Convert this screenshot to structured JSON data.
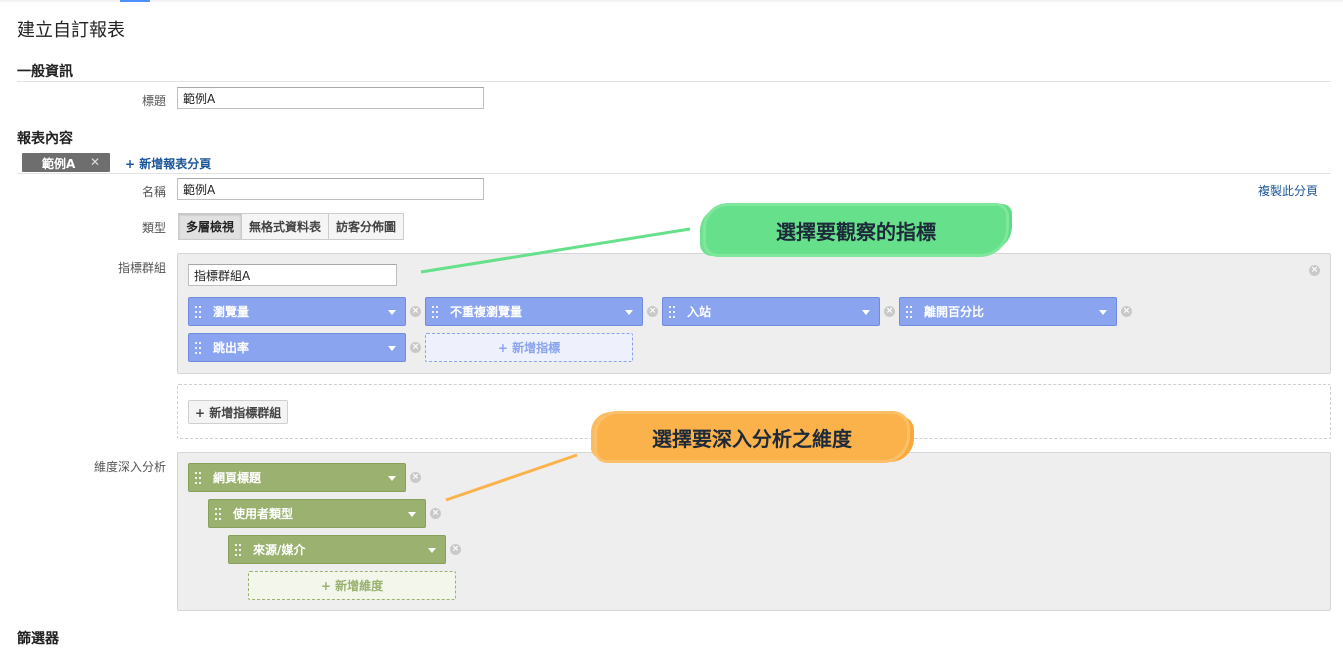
{
  "page": {
    "title": "建立自訂報表"
  },
  "general": {
    "section_title": "一般資訊",
    "title_label": "標題",
    "title_value": "範例A"
  },
  "content": {
    "section_title": "報表內容",
    "tab_label": "範例A",
    "tab_close": "✕",
    "add_tab_label": "+ 新增報表分頁",
    "copy_tab_label": "複製此分頁",
    "name_label": "名稱",
    "name_value": "範例A",
    "type_label": "類型",
    "types": [
      "多層檢視",
      "無格式資料表",
      "訪客分佈圖"
    ],
    "selected_type": "多層檢視"
  },
  "metrics": {
    "label": "指標群組",
    "group_name": "指標群組A",
    "items": [
      "瀏覽量",
      "不重複瀏覽量",
      "入站",
      "離開百分比",
      "跳出率"
    ],
    "add_metric_label": "+ 新增指標",
    "add_group_label": "+ 新增指標群組",
    "color": "#8aa4f0"
  },
  "dimensions": {
    "label": "維度深入分析",
    "items": [
      "網頁標題",
      "使用者類型",
      "來源/媒介"
    ],
    "add_dimension_label": "+ 新增維度",
    "color": "#9ab170"
  },
  "annotations": {
    "metrics_callout": "選擇要觀察的指標",
    "dimensions_callout": "選擇要深入分析之維度",
    "metrics_color": "#66e08a",
    "dimensions_color": "#fbb24b"
  },
  "footer": {
    "next_section": "篩選器"
  },
  "icons": {
    "remove": "x-circle-icon",
    "dropdown": "caret-down-icon",
    "drag": "drag-handle-icon"
  }
}
